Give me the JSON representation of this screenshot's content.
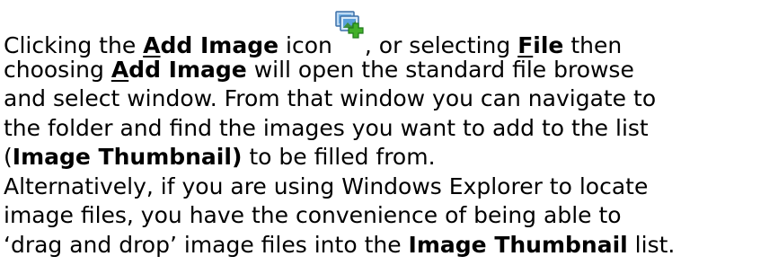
{
  "paragraph1": {
    "line1": {
      "t1": "Clicking the ",
      "add_A": "A",
      "add_rest": "dd Image",
      "t2": " icon",
      "t3": ", or selecting ",
      "file_F": "F",
      "file_rest": "ile",
      "t4": " then"
    },
    "line2": {
      "t1": "choosing ",
      "add_A": "A",
      "add_rest": "dd Image",
      "t2": " will open the standard file browse"
    },
    "line3": "and select window. From that window you can navigate to",
    "line4": "the folder and find the images you want to add to the list",
    "line5": {
      "open": "(",
      "bold": "Image Thumbnail)",
      "rest": " to be filled from."
    }
  },
  "paragraph2": {
    "line1": "Alternatively, if you are using Windows Explorer to locate",
    "line2": "image files, you have the convenience of being able to",
    "line3": {
      "t1": "‘drag and drop’ image files into the ",
      "bold": "Image Thumbnail",
      "t2": " list."
    }
  },
  "icons": {
    "add_image": "add-image-icon"
  }
}
